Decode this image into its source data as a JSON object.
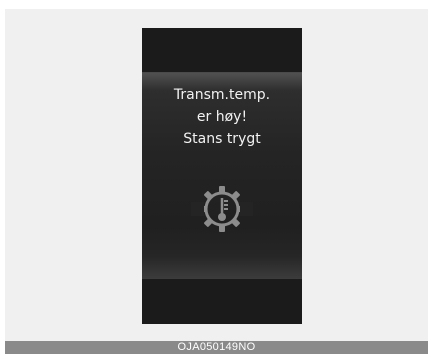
{
  "display": {
    "message_lines": [
      "Transm.temp.",
      "er høy!",
      "Stans trygt"
    ],
    "icon": "transmission-temperature-warning-icon"
  },
  "caption": {
    "code": "OJA050149NO"
  },
  "colors": {
    "frame_background": "#f0f0f0",
    "display_background": "#1b1b1b",
    "text": "#f2f2f2",
    "icon": "#8c8c8c",
    "caption_bar": "#8a8a8a"
  }
}
